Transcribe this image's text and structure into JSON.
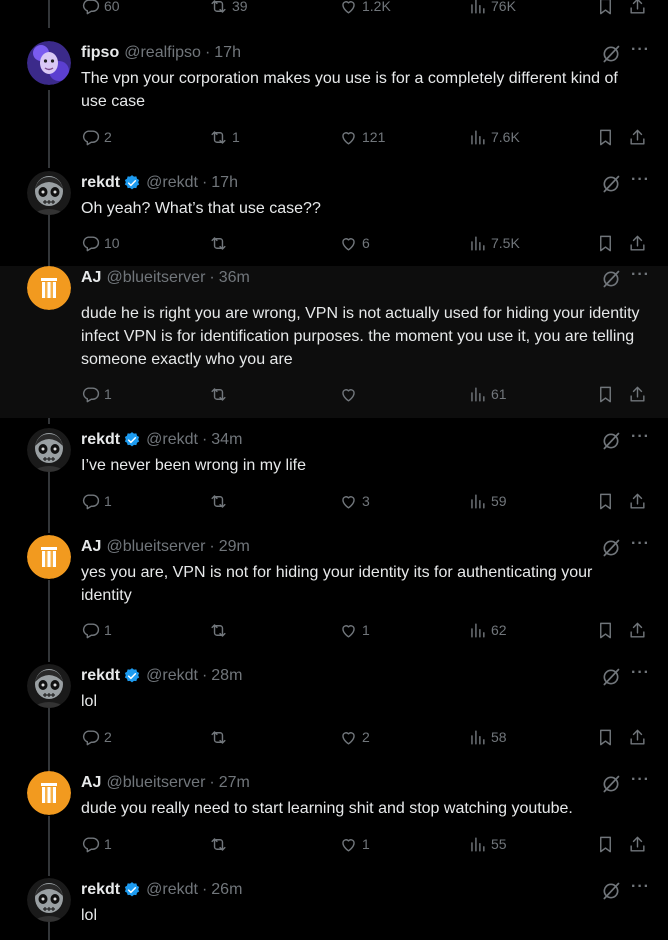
{
  "top_partial": {
    "replies": "60",
    "reposts": "39",
    "likes": "1.2K",
    "views": "76K"
  },
  "tweets": [
    {
      "name": "fipso",
      "verified": false,
      "handle": "@realfipso",
      "time": "17h",
      "text": "The vpn your corporation makes you use is for a completely different kind of use case",
      "replies": "2",
      "reposts": "1",
      "likes": "121",
      "views": "7.6K",
      "avatar": "fipso-avatar"
    },
    {
      "name": "rekdt",
      "verified": true,
      "handle": "@rekdt",
      "time": "17h",
      "text": "Oh yeah? What’s that use case??",
      "replies": "10",
      "reposts": "",
      "likes": "6",
      "views": "7.5K",
      "avatar": "skull-avatar"
    },
    {
      "name": "AJ",
      "verified": false,
      "handle": "@blueitserver",
      "time": "36m",
      "text": "dude he is right you are wrong, VPN is not actually used for hiding your identity infect VPN is for identification purposes. the moment you use it, you are telling someone exactly who you are",
      "replies": "1",
      "reposts": "",
      "likes": "",
      "views": "61",
      "avatar": "aj-avatar"
    },
    {
      "name": "rekdt",
      "verified": true,
      "handle": "@rekdt",
      "time": "34m",
      "text": "I’ve never been wrong in my life",
      "replies": "1",
      "reposts": "",
      "likes": "3",
      "views": "59",
      "avatar": "skull-avatar"
    },
    {
      "name": "AJ",
      "verified": false,
      "handle": "@blueitserver",
      "time": "29m",
      "text": "yes you are, VPN is not for hiding your identity its for authenticating your identity",
      "replies": "1",
      "reposts": "",
      "likes": "1",
      "views": "62",
      "avatar": "aj-avatar"
    },
    {
      "name": "rekdt",
      "verified": true,
      "handle": "@rekdt",
      "time": "28m",
      "text": "lol",
      "replies": "2",
      "reposts": "",
      "likes": "2",
      "views": "58",
      "avatar": "skull-avatar"
    },
    {
      "name": "AJ",
      "verified": false,
      "handle": "@blueitserver",
      "time": "27m",
      "text": "dude you really need to start learning shit and stop watching youtube.",
      "replies": "1",
      "reposts": "",
      "likes": "1",
      "views": "55",
      "avatar": "aj-avatar"
    },
    {
      "name": "rekdt",
      "verified": true,
      "handle": "@rekdt",
      "time": "26m",
      "text": "lol",
      "replies": "",
      "reposts": "",
      "likes": "",
      "views": "",
      "avatar": "skull-avatar"
    }
  ],
  "colors": {
    "background": "#000000",
    "highlight": "#0d0d0d",
    "muted": "#71767b",
    "text": "#e7e9ea",
    "verified": "#1d9bf0",
    "aj_orange": "#f29a1f"
  }
}
